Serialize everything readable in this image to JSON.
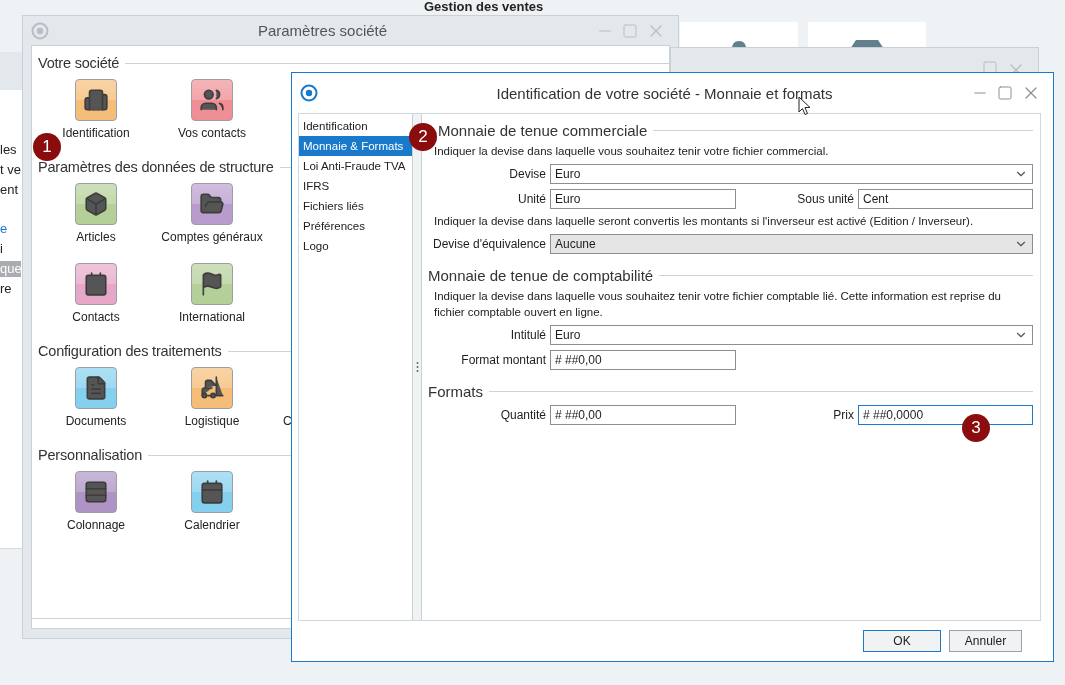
{
  "background_app": {
    "heading": "Gestion des ventes",
    "sidebar_items": [
      {
        "label": "les",
        "kind": "plain",
        "selected": false
      },
      {
        "label": "t ve",
        "kind": "plain",
        "selected": false
      },
      {
        "label": "ent",
        "kind": "plain",
        "selected": false
      },
      {
        "label": "e",
        "kind": "link",
        "selected": false
      },
      {
        "label": "i",
        "kind": "plain",
        "selected": false
      },
      {
        "label": "que",
        "kind": "plain",
        "selected": true
      },
      {
        "label": "re",
        "kind": "plain",
        "selected": false
      }
    ]
  },
  "settings_window": {
    "title": "Paramètres société",
    "sections": [
      {
        "title": "Votre société",
        "rows": [
          [
            {
              "label": "Identification",
              "color": "#f6bd78"
            },
            {
              "label": "Vos contacts",
              "color": "#ef8f95"
            }
          ]
        ]
      },
      {
        "title": "Paramètres des données de structure",
        "rows": [
          [
            {
              "label": "Articles",
              "color": "#b5cf98"
            },
            {
              "label": "Comptes généraux",
              "color": "#b99ccd"
            }
          ],
          [
            {
              "label": "Contacts",
              "color": "#e7a7c9"
            },
            {
              "label": "International",
              "color": "#b5cf98"
            }
          ]
        ]
      },
      {
        "title": "Configuration des traitements",
        "rows": [
          [
            {
              "label": "Documents",
              "color": "#84d0ee"
            },
            {
              "label": "Logistique",
              "color": "#f6bd78"
            },
            {
              "label": "C"
            }
          ]
        ]
      },
      {
        "title": "Personnalisation",
        "rows": [
          [
            {
              "label": "Colonnage",
              "color": "#ae93c4"
            },
            {
              "label": "Calendrier",
              "color": "#84d0ee"
            }
          ]
        ]
      }
    ]
  },
  "dialog": {
    "title": "Identification de votre société - Monnaie et formats",
    "nav": [
      {
        "label": "Identification",
        "selected": false
      },
      {
        "label": "Monnaie & Formats",
        "selected": true
      },
      {
        "label": "Loi Anti-Fraude TVA",
        "selected": false
      },
      {
        "label": "IFRS",
        "selected": false
      },
      {
        "label": "Fichiers liés",
        "selected": false
      },
      {
        "label": "Préférences",
        "selected": false
      },
      {
        "label": "Logo",
        "selected": false
      }
    ],
    "groups": [
      {
        "title": "Monnaie de tenue commerciale",
        "rows": [
          {
            "kind": "note",
            "text": "Indiquer la devise dans laquelle vous souhaitez tenir votre fichier commercial."
          },
          {
            "kind": "select",
            "label": "Devise",
            "value": "Euro",
            "disabled": false
          },
          {
            "kind": "pair",
            "fields": [
              {
                "label": "Unité",
                "value": "Euro",
                "focused": false
              },
              {
                "label": "Sous unité",
                "value": "Cent",
                "focused": false
              }
            ]
          },
          {
            "kind": "note",
            "text": "Indiquer la devise dans laquelle seront convertis les montants si l'inverseur est activé (Edition / Inverseur)."
          },
          {
            "kind": "select",
            "label": "Devise d'équivalence",
            "value": "Aucune",
            "disabled": true
          }
        ]
      },
      {
        "title": "Monnaie de tenue de comptabilité",
        "rows": [
          {
            "kind": "note",
            "text": "Indiquer la devise dans laquelle vous souhaitez tenir votre fichier comptable lié. Cette information est reprise du fichier comptable ouvert en ligne."
          },
          {
            "kind": "select",
            "label": "Intitulé",
            "value": "Euro",
            "disabled": false
          },
          {
            "kind": "input",
            "label": "Format montant",
            "value": "# ##0,00",
            "focused": false
          }
        ]
      },
      {
        "title": "Formats",
        "rows": [
          {
            "kind": "pair",
            "fields": [
              {
                "label": "Quantité",
                "value": "# ##0,00",
                "focused": false
              },
              {
                "label": "Prix",
                "value": "# ##0,0000",
                "focused": true
              }
            ]
          }
        ]
      }
    ],
    "buttons": [
      {
        "label": "OK",
        "kind": "default"
      },
      {
        "label": "Annuler",
        "kind": "normal"
      }
    ]
  },
  "callouts": [
    {
      "label": "1"
    },
    {
      "label": "2"
    },
    {
      "label": "3"
    }
  ]
}
